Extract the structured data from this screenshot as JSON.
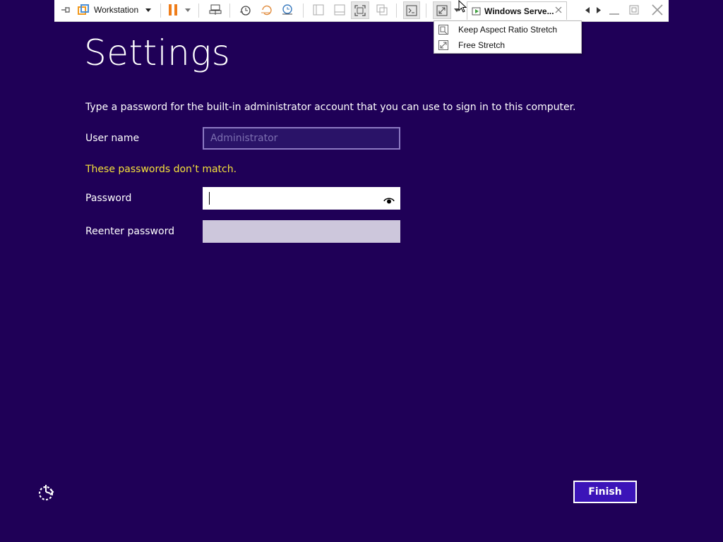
{
  "toolbar": {
    "library_label": "Workstation",
    "vm_tab_title": "Windows Serve..."
  },
  "menu": {
    "items": [
      {
        "label": "Keep Aspect Ratio Stretch",
        "icon": "aspect-stretch-icon"
      },
      {
        "label": "Free Stretch",
        "icon": "free-stretch-icon"
      }
    ]
  },
  "setup": {
    "title": "Settings",
    "instruction": "Type a password for the built-in administrator account that you can use to sign in to this computer.",
    "username_label": "User name",
    "username_value": "Administrator",
    "error_message": "These passwords don’t match.",
    "password_label": "Password",
    "reenter_label": "Reenter password",
    "finish_label": "Finish"
  },
  "colors": {
    "background": "#1f0057",
    "error": "#f5e13a",
    "accent": "#3b14b8"
  }
}
